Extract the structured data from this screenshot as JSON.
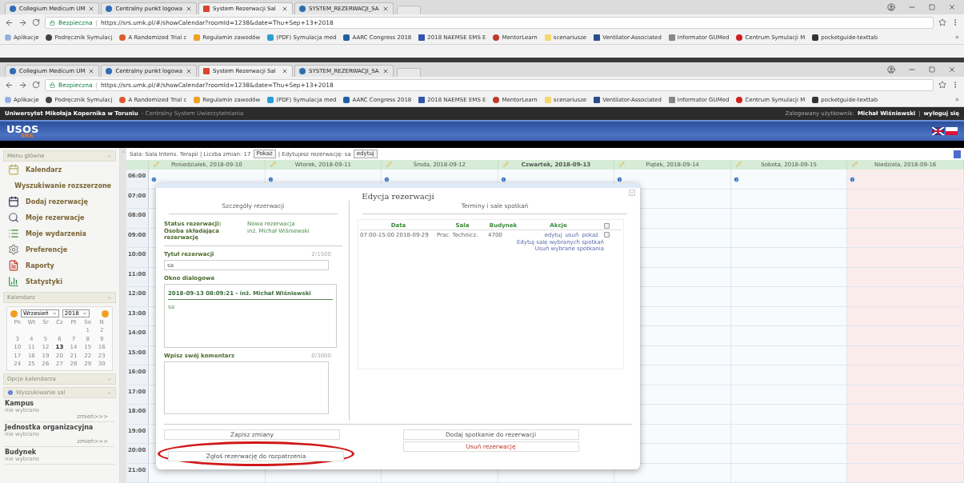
{
  "browser_windows": [
    {
      "tabs": [
        {
          "title": "Collegium Medicum UM",
          "selected": false
        },
        {
          "title": "Centralny punkt logowa",
          "selected": false
        },
        {
          "title": "System Rezerwacji Sal",
          "selected": true
        },
        {
          "title": "SYSTEM_REZERWACJI_SA",
          "selected": false
        }
      ],
      "security_label": "Bezpieczna",
      "separator": "|",
      "url": "https://srs.umk.pl/#/showCalendar?roomId=1238&date=Thu+Sep+13+2018",
      "bookmarks": [
        "Aplikacje",
        "Podręcznik Symulacj",
        "A Randomized Trial c",
        "Regulamin zawodów",
        "(PDF) Symulacja med",
        "AARC Congress 2018",
        "2018 NAEMSE EMS E",
        "MentorLearn",
        "scenariusze",
        "Ventilator-Associated",
        "Informator GUMed",
        "Centrum Symulacji M",
        "pocketguide-texttab"
      ],
      "more": "»"
    },
    {
      "tabs": [
        {
          "title": "Collegium Medicum UM",
          "selected": false
        },
        {
          "title": "Centralny punkt logowa",
          "selected": false
        },
        {
          "title": "System Rezerwacji Sal",
          "selected": true
        },
        {
          "title": "SYSTEM_REZERWACJI_SA",
          "selected": false
        }
      ],
      "security_label": "Bezpieczna",
      "separator": "|",
      "url": "https://srs.umk.pl/#/showCalendar?roomId=1238&date=Thu+Sep+13+2018",
      "bookmarks": [
        "Aplikacje",
        "Podręcznik Symulacj",
        "A Randomized Trial c",
        "Regulamin zawodów",
        "(PDF) Symulacja med",
        "AARC Congress 2018",
        "2018 NAEMSE EMS E",
        "MentorLearn",
        "scenariusze",
        "Ventilator-Associated",
        "Informator GUMed",
        "Centrum Symulacji M",
        "pocketguide-texttab"
      ],
      "more": "»"
    }
  ],
  "top_bar": {
    "university": "Uniwersytet Mikołaja Kopernika w Toruniu",
    "system": "- Centralny System Uwierzytelniania",
    "user_label": "Zalogowany użytkownik:",
    "user_name": "Michał Wiśniewski",
    "separator": "|",
    "logout": "wyloguj się"
  },
  "logo": {
    "title": "USOS",
    "subtitle": "SRS"
  },
  "sidebar": {
    "menu_title": "Menu główne",
    "menu_items": [
      "Kalendarz",
      "Wyszukiwanie rozszerzone",
      "Dodaj rezerwację",
      "Moje rezerwacje",
      "Moje wydarzenia",
      "Preferencje",
      "Raporty",
      "Statystyki"
    ],
    "calendar_title": "Kalendarz",
    "month": "Wrzesień",
    "year": "2018",
    "weekdays": [
      "Pn",
      "Wt",
      "Śr",
      "Cz",
      "Pt",
      "So",
      "N"
    ],
    "weeks": [
      [
        {
          "d": "1",
          "selected": false
        },
        {
          "d": "2",
          "selected": false
        }
      ],
      [
        {
          "d": "3",
          "selected": false
        },
        {
          "d": "4",
          "selected": false
        },
        {
          "d": "5",
          "selected": false
        },
        {
          "d": "6",
          "selected": false
        },
        {
          "d": "7",
          "selected": false
        },
        {
          "d": "8",
          "selected": false
        },
        {
          "d": "9",
          "selected": false
        }
      ],
      [
        {
          "d": "10",
          "selected": false
        },
        {
          "d": "11",
          "selected": false
        },
        {
          "d": "12",
          "selected": false
        },
        {
          "d": "13",
          "selected": true
        },
        {
          "d": "14",
          "selected": false
        },
        {
          "d": "15",
          "selected": false
        },
        {
          "d": "16",
          "selected": false
        }
      ],
      [
        {
          "d": "17",
          "selected": false
        },
        {
          "d": "18",
          "selected": false
        },
        {
          "d": "19",
          "selected": false
        },
        {
          "d": "20",
          "selected": false
        },
        {
          "d": "21",
          "selected": false
        },
        {
          "d": "22",
          "selected": false
        },
        {
          "d": "23",
          "selected": false
        }
      ],
      [
        {
          "d": "24",
          "selected": false
        },
        {
          "d": "25",
          "selected": false
        },
        {
          "d": "26",
          "selected": false
        },
        {
          "d": "27",
          "selected": false
        },
        {
          "d": "28",
          "selected": false
        },
        {
          "d": "29",
          "selected": false
        },
        {
          "d": "30",
          "selected": false
        }
      ]
    ],
    "options_title": "Opcje kalendarza",
    "search_title": "Wyszukiwanie sal",
    "filters": [
      {
        "label": "Kampus",
        "value": "nie wybrano",
        "change": "zmień>>>"
      },
      {
        "label": "Jednostka organizacyjna",
        "value": "nie wybrano",
        "change": "zmień>>>"
      },
      {
        "label": "Budynek",
        "value": "nie wybrano"
      }
    ]
  },
  "toolbar": {
    "room": "Sala: Sala Intens. Terapii | Liczba zmian: 17",
    "show_button": "Pokaż",
    "editing": "| Edytujesz rezerwację: sa",
    "edit_button": "edytuj"
  },
  "calendar": {
    "days": [
      {
        "label": "Poniedziałek, 2018-09-10",
        "selected": false,
        "holiday": false
      },
      {
        "label": "Wtorek, 2018-09-11",
        "selected": false,
        "holiday": false
      },
      {
        "label": "Środa, 2018-09-12",
        "selected": false,
        "holiday": false
      },
      {
        "label": "Czwartek, 2018-09-13",
        "selected": true,
        "holiday": false
      },
      {
        "label": "Piątek, 2018-09-14",
        "selected": false,
        "holiday": false
      },
      {
        "label": "Sobota, 2018-09-15",
        "selected": false,
        "holiday": false
      },
      {
        "label": "Niedziela, 2018-09-16",
        "selected": false,
        "holiday": true
      }
    ],
    "hours": [
      "06:00",
      "07:00",
      "08:00",
      "09:00",
      "10:00",
      "11:00",
      "12:00",
      "13:00",
      "14:00",
      "15:00",
      "16:00",
      "17:00",
      "18:00",
      "19:00",
      "20:00",
      "21:00"
    ]
  },
  "dialog": {
    "title": "Edycja rezerwacji",
    "details": {
      "heading": "Szczegóły rezerwacji",
      "status_label": "Status rezerwacji:",
      "status": "Nowa rezerwacja",
      "person_label": "Osoba składająca rezerwację",
      "person": "inż. Michał Wiśniewski",
      "title_label": "Tytuł rezerwacji",
      "title_counter": "2/1500",
      "title_value": "sa",
      "chat_label": "Okno dialogowe",
      "message_header": "2018-09-13 08:09:21 - inż. Michał Wiśniewski",
      "message_body": "sa",
      "comment_label": "Wpisz swój komentarz",
      "comment_counter": "0/3000"
    },
    "meetings": {
      "heading": "Terminy i sale spotkań",
      "columns": [
        "Data",
        "Sala",
        "Budynek",
        "Akcje"
      ],
      "select_all_checked": false,
      "rows": [
        {
          "date": "07:00-15:00 2018-09-29",
          "room": "Prac. Technicz.",
          "building": "4700",
          "edit": "edytuj",
          "delete": "usuń",
          "show": "pokaż",
          "checked": false
        }
      ],
      "links": [
        "Edytuj salę wybranych spotkań",
        "Usuń wybrane spotkania"
      ]
    },
    "buttons": [
      {
        "label": "Zapisz zmiany",
        "kind": "neutral"
      },
      {
        "label": "Zgłoś rezerwację do rozpatrzenia",
        "kind": "neutral"
      },
      {
        "label": "Dodaj spotkanie do rezerwacji",
        "kind": "neutral"
      },
      {
        "label": "Usuń rezerwację",
        "kind": "danger"
      }
    ]
  }
}
